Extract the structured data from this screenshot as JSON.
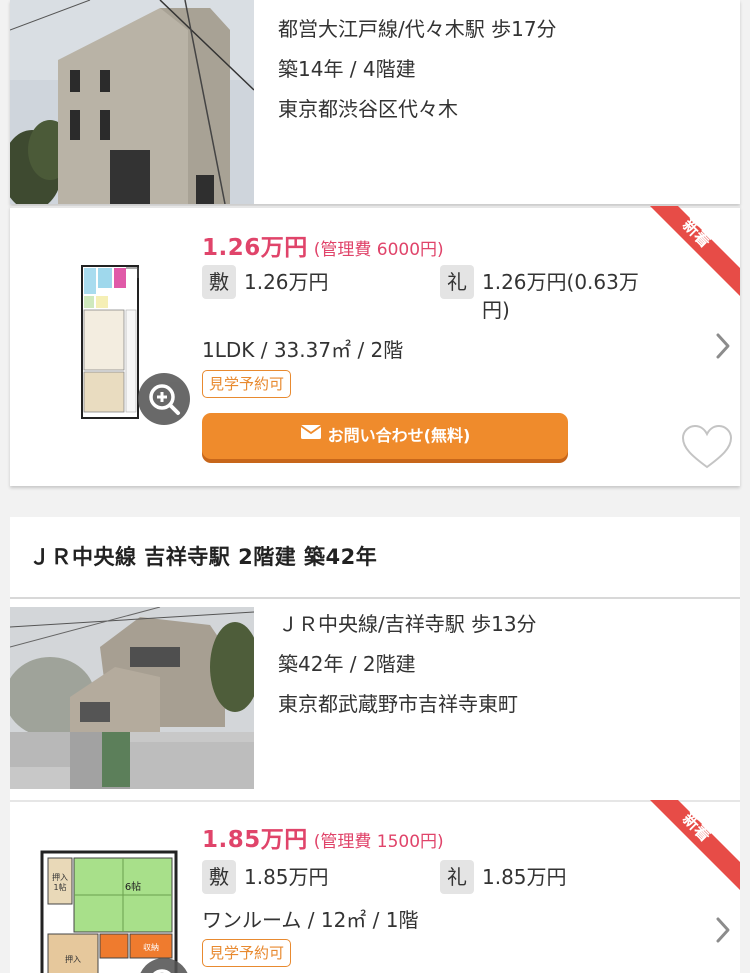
{
  "listings": [
    {
      "building": {
        "station": "都営大江戸線/代々木駅 歩17分",
        "age_floors": "築14年 / 4階建",
        "address": "東京都渋谷区代々木"
      },
      "room": {
        "rent": "1.26万円",
        "management_fee": "(管理費 6000円)",
        "deposit_label": "敷",
        "deposit_value": "1.26万円",
        "key_money_label": "礼",
        "key_money_value": "1.26万円(0.63万円)",
        "spec": "1LDK / 33.37㎡ / 2階",
        "tour_tag": "見学予約可",
        "inquiry_label": "お問い合わせ(無料)",
        "new_badge": "新着"
      }
    },
    {
      "title": "ＪＲ中央線 吉祥寺駅 2階建 築42年",
      "building": {
        "station": "ＪＲ中央線/吉祥寺駅 歩13分",
        "age_floors": "築42年 / 2階建",
        "address": "東京都武蔵野市吉祥寺東町"
      },
      "room": {
        "rent": "1.85万円",
        "management_fee": "(管理費 1500円)",
        "deposit_label": "敷",
        "deposit_value": "1.85万円",
        "key_money_label": "礼",
        "key_money_value": "1.85万円",
        "spec": "ワンルーム / 12㎡ / 1階",
        "tour_tag": "見学予約可",
        "new_badge": "新着",
        "floorplan_labels": {
          "closet": "押入",
          "six_jo": "6帖",
          "storage": "収納",
          "closet_tag": "押入",
          "closet_tag_sub": "1帖"
        }
      }
    }
  ],
  "colors": {
    "price": "#e0446a",
    "accent_orange": "#ef8b2c",
    "ribbon": "#e74c47"
  },
  "icons": [
    "mail-icon",
    "zoom-in-icon",
    "chevron-right-icon",
    "heart-icon"
  ]
}
